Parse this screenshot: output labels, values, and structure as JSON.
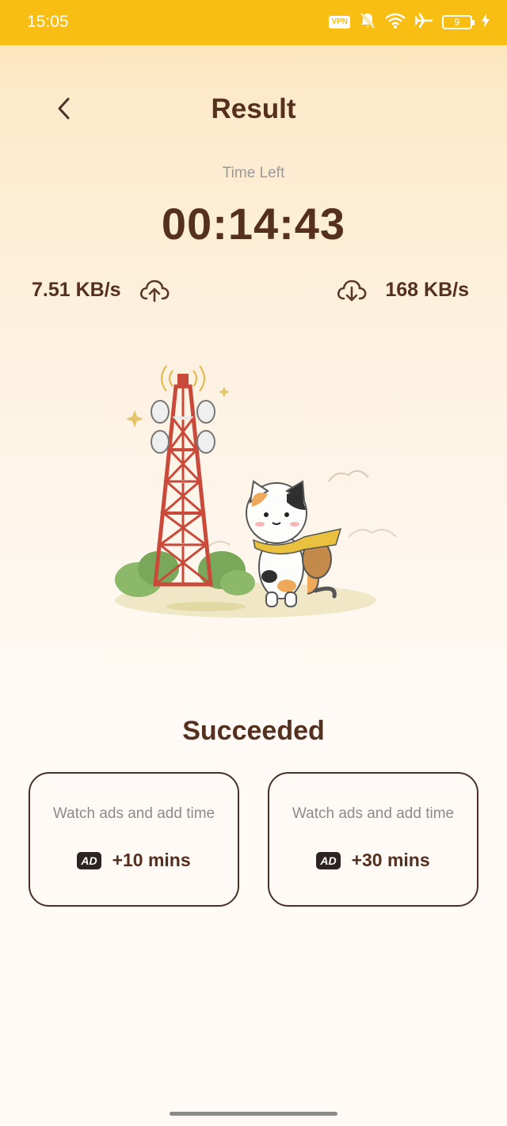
{
  "status_bar": {
    "time": "15:05",
    "vpn_label": "VPN",
    "battery_level": "9",
    "background_color": "#f8be14",
    "icons": [
      "vpn-icon",
      "bell-off-icon",
      "wifi-icon",
      "airplane-icon",
      "battery-icon",
      "charging-icon"
    ]
  },
  "header": {
    "title": "Result",
    "back_icon": "chevron-left-icon"
  },
  "timer": {
    "label": "Time Left",
    "value": "00:14:43"
  },
  "speeds": {
    "upload": {
      "value": "7.51 KB/s",
      "icon": "cloud-upload-icon"
    },
    "download": {
      "value": "168 KB/s",
      "icon": "cloud-download-icon"
    }
  },
  "illustration": {
    "icon": "cell-tower-cat-illustration"
  },
  "result": {
    "status": "Succeeded"
  },
  "ad_options": [
    {
      "title": "Watch ads and add time",
      "badge": "AD",
      "amount": "+10 mins"
    },
    {
      "title": "Watch ads and add time",
      "badge": "AD",
      "amount": "+30 mins"
    }
  ],
  "colors": {
    "primary_text": "#55301f",
    "muted_text": "#9a9a9a",
    "accent": "#f8be14"
  }
}
